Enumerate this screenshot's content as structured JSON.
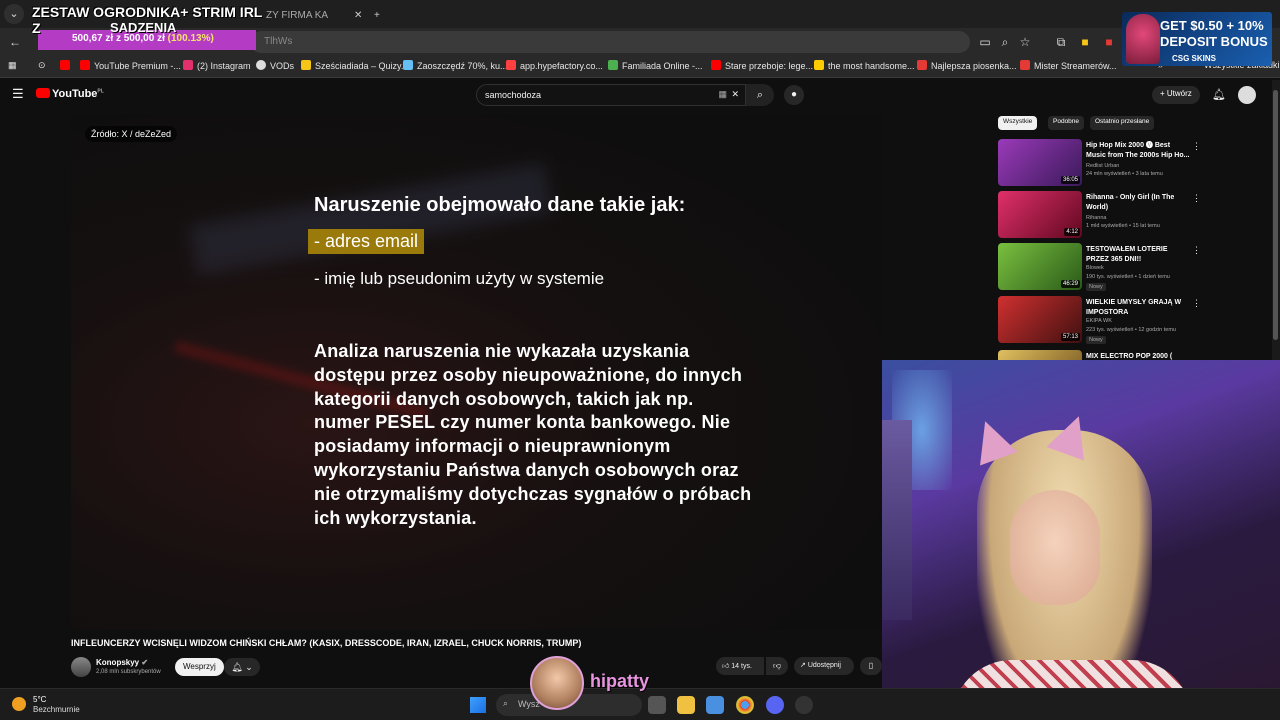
{
  "browser": {
    "tabs": [
      "ZY FIRMA KA"
    ],
    "omnibox_text": "TlhWs",
    "bookmarks": [
      {
        "label": "YouTube Premium -...",
        "color": "#ff0000"
      },
      {
        "label": "(2) Instagram",
        "color": "#e1306c"
      },
      {
        "label": "VODs",
        "color": "#ffffff"
      },
      {
        "label": "Sześciadiada – Quizy...",
        "color": "#f5c518"
      },
      {
        "label": "Zaoszczędź 70%, ku...",
        "color": "#66c0f4"
      },
      {
        "label": "app.hypefactory.co...",
        "color": "#ff4040"
      },
      {
        "label": "Familiada Online -...",
        "color": "#4caf50"
      },
      {
        "label": "Stare przeboje: lege...",
        "color": "#ff0000"
      },
      {
        "label": "the most handsome...",
        "color": "#ffcc00"
      },
      {
        "label": "Najlepsza piosenka...",
        "color": "#e53935"
      },
      {
        "label": "Mister Streamerów...",
        "color": "#e53935"
      }
    ],
    "all_bookmarks": "Wszystkie zakładki"
  },
  "overlay": {
    "donation_title": "ZESTAW OGRODNIKA+ STRIM IRL Z",
    "donation_sub": "SADZENIA",
    "donation_amount": "500,67 zł",
    "donation_sep": "z",
    "donation_goal": "500,00 zł",
    "donation_pct": "(100.13%)",
    "ad_line1": "GET $0.50 + 10%",
    "ad_line2": "DEPOSIT BONUS",
    "ad_brand": "CSG SKINS",
    "streamer_name": "hipatty"
  },
  "youtube": {
    "logo": "YouTube",
    "logo_region": "PL",
    "search_query": "samochodoza",
    "create_label": "Utwórz",
    "video": {
      "source": "Źródło: X / deZeZed",
      "heading": "Naruszenie obejmowało dane takie jak:",
      "highlight": "- adres email",
      "item": "-  imię lub pseudonim użyty w systemie",
      "paragraph": "Analiza naruszenia nie wykazała uzyskania dostępu przez osoby nieupoważnione, do innych kategorii danych osobowych, takich jak np. numer PESEL czy numer konta bankowego. Nie posiadamy informacji o nieuprawnionym wykorzystaniu Państwa danych osobowych oraz nie otrzymaliśmy dotychczas sygnałów o próbach ich wykorzystania."
    },
    "title": "INFLEUNCERZY WCISNĘLI WIDZOM CHIŃSKI CHŁAM? (KASIX, DRESSCODE, IRAN, IZRAEL, CHUCK NORRIS, TRUMP)",
    "channel": "Konopskyy",
    "subscribers": "2,08 mln subskrybentów",
    "support_label": "Wesprzyj",
    "likes": "14 tys.",
    "share_label": "Udostępnij",
    "chips": [
      "Wszystkie",
      "Podobne",
      "Ostatnio przesłane"
    ],
    "recommendations": [
      {
        "title": "Hip Hop Mix 2000 🅥 Best Music from The 2000s Hip Ho...",
        "channel": "Redlist Urban",
        "meta": "24 mln wyświetleń • 3 lata temu",
        "duration": "36:05",
        "thumb": "#6a2a8a",
        "new": ""
      },
      {
        "title": "Rihanna - Only Girl (In The World)",
        "channel": "Rihanna",
        "meta": "1 mld wyświetleń • 15 lat temu",
        "duration": "4:12",
        "thumb": "#c01040",
        "new": ""
      },
      {
        "title": "TESTOWAŁEM LOTERIE PRZEZ 365 DNI!!",
        "channel": "Blowek",
        "meta": "190 tys. wyświetleń • 1 dzień temu",
        "duration": "46:29",
        "thumb": "#4a8a2a",
        "new": "Nowy"
      },
      {
        "title": "WIELKIE UMYSŁY GRAJĄ W IMPOSTORA",
        "channel": "EKIPA WK",
        "meta": "223 tys. wyświetleń • 12 godzin temu",
        "duration": "57:13",
        "thumb": "#a02020",
        "new": "Nowy"
      },
      {
        "title": "MIX ELECTRO POP 2000 (",
        "channel": "",
        "meta": "",
        "duration": "",
        "thumb": "#8a6a2a",
        "new": ""
      }
    ]
  },
  "taskbar": {
    "temp": "5°C",
    "weather": "Bezchmurnie",
    "search_placeholder": "Wysz"
  }
}
